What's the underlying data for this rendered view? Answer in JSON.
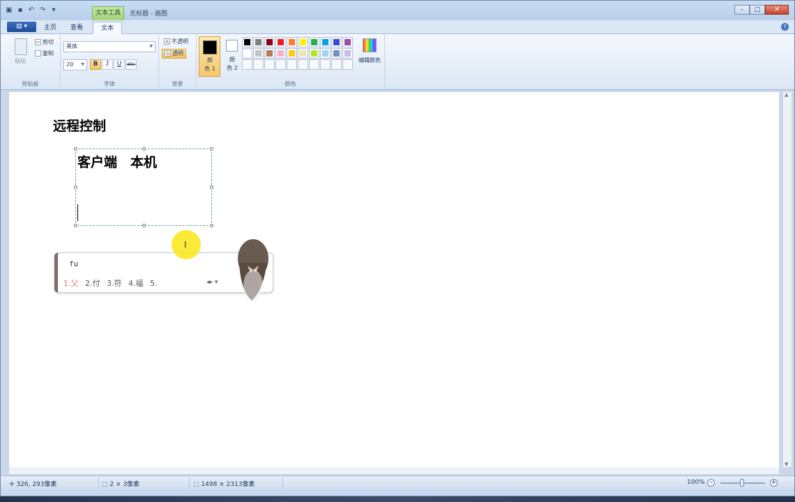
{
  "window": {
    "context_tab": "文本工具",
    "title": "无标题 - 画图"
  },
  "tabs": [
    {
      "label": "主页"
    },
    {
      "label": "查看"
    },
    {
      "label": "文本"
    }
  ],
  "ribbon": {
    "clipboard": {
      "paste": "粘贴",
      "cut": "剪切",
      "copy": "复制",
      "group_label": "剪贴板"
    },
    "font": {
      "font_name": "黑体",
      "font_size": "20",
      "bold": "B",
      "italic": "I",
      "underline": "U",
      "strike": "abc",
      "group_label": "字体"
    },
    "background": {
      "opaque": "不透明",
      "transparent": "透明",
      "group_label": "背景"
    },
    "colors": {
      "color1_top": "颜",
      "color1_bottom": "色 1",
      "color2_top": "颜",
      "color2_bottom": "色 2",
      "edit_colors": "编辑颜色",
      "group_label": "颜色",
      "palette": [
        "#000000",
        "#7f7f7f",
        "#880015",
        "#ed1c24",
        "#ff7f27",
        "#fff200",
        "#22b14c",
        "#00a2e8",
        "#3f48cc",
        "#a349a4",
        "#ffffff",
        "#c3c3c3",
        "#b97a57",
        "#ffaec9",
        "#ffc90e",
        "#efe4b0",
        "#b5e61d",
        "#99d9ea",
        "#7092be",
        "#c8bfe7",
        "",
        "",
        "",
        "",
        "",
        "",
        "",
        "",
        "",
        ""
      ]
    }
  },
  "canvas": {
    "heading": "远程控制",
    "textbox_text": "客户端　本机"
  },
  "ime": {
    "input": "fu",
    "candidates": [
      "1.父",
      "2.付",
      "3.符",
      "4.福",
      "5."
    ]
  },
  "statusbar": {
    "cursor_pos": "326, 293像素",
    "selection_size": "2 × 3像素",
    "image_size": "1498 × 2313像素",
    "zoom": "100%"
  }
}
